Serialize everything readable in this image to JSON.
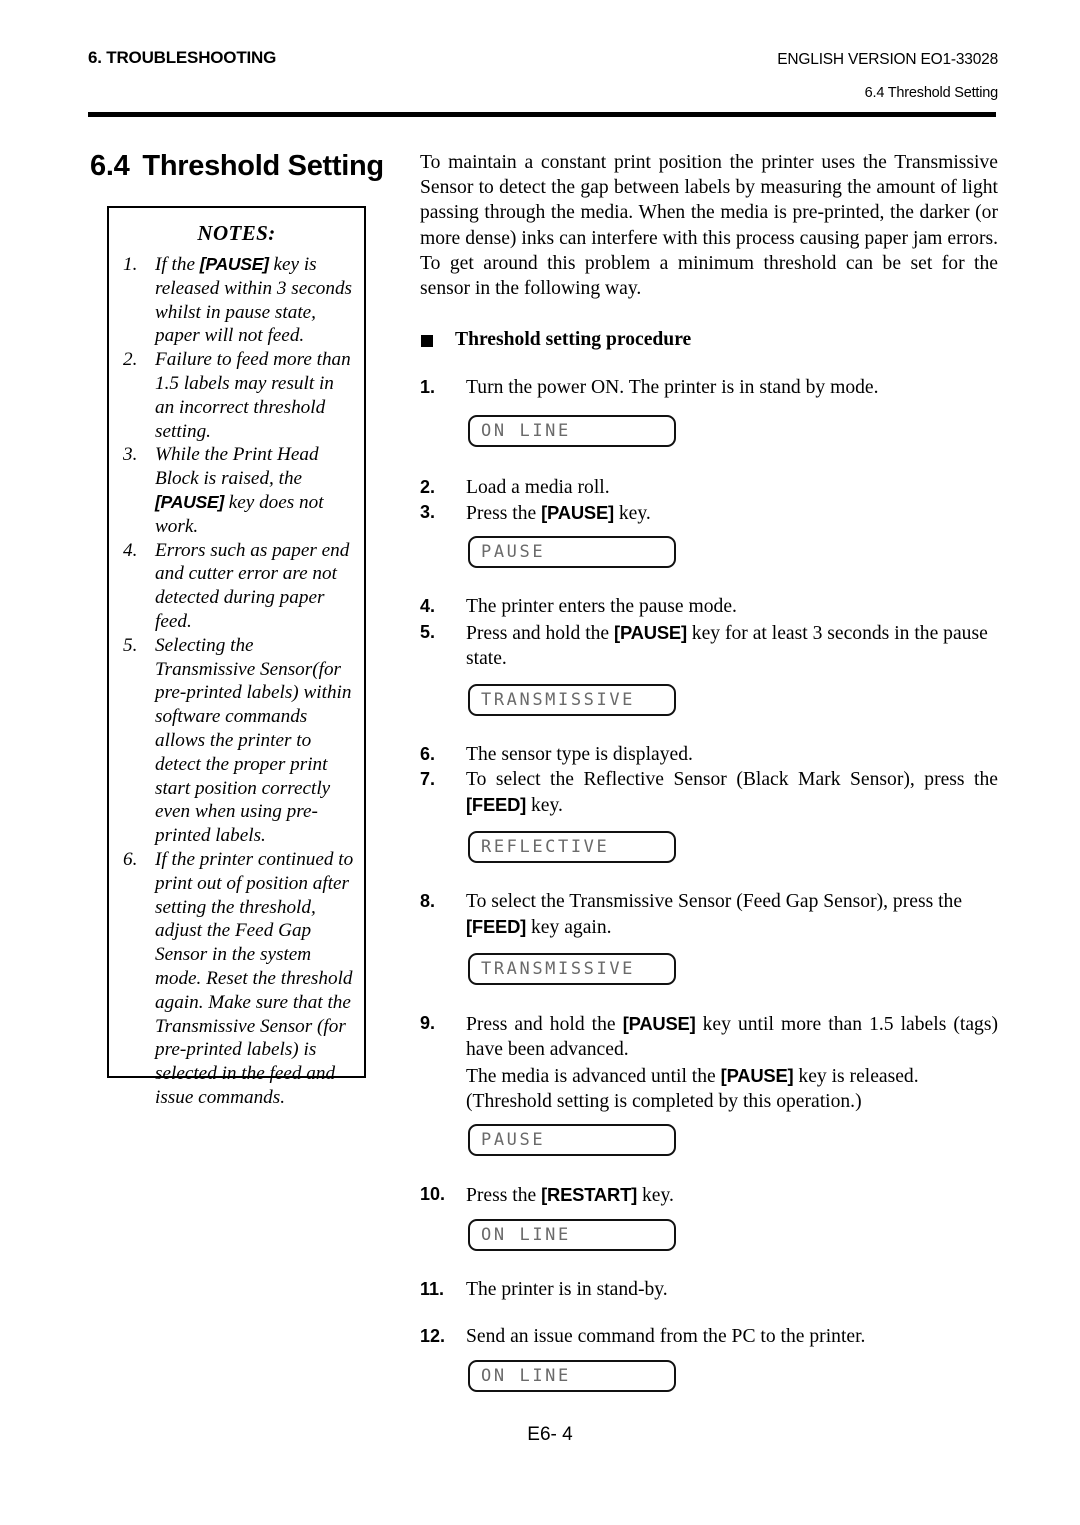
{
  "header": {
    "left": "6. TROUBLESHOOTING",
    "right": "ENGLISH VERSION EO1-33028",
    "sub": "6.4 Threshold Setting"
  },
  "section": {
    "number": "6.4",
    "title": "Threshold Setting"
  },
  "notes": {
    "title": "NOTES:",
    "items": [
      {
        "num": "1.",
        "pre": "If the ",
        "key": "[PAUSE]",
        "post": " key is released within 3 seconds whilst in pause state, paper will not feed."
      },
      {
        "num": "2.",
        "pre": "Failure to feed more than 1.5 labels may result in an incorrect threshold setting.",
        "key": "",
        "post": ""
      },
      {
        "num": "3.",
        "pre": "While the Print Head Block is raised, the ",
        "key": "[PAUSE]",
        "post": " key does not work."
      },
      {
        "num": "4.",
        "pre": "Errors such as paper end and cutter error are not detected during paper feed.",
        "key": "",
        "post": ""
      },
      {
        "num": "5.",
        "pre": "Selecting the Transmissive Sensor(for pre-printed labels) within software commands allows the printer to detect the proper print start position correctly even when using pre-printed labels.",
        "key": "",
        "post": ""
      },
      {
        "num": "6.",
        "pre": "If the printer continued to print out of position after setting the threshold, adjust the Feed Gap Sensor in the system mode.  Reset the threshold again.  Make sure that the Transmissive Sensor (for pre-printed labels) is selected in the feed and issue commands.",
        "key": "",
        "post": ""
      }
    ]
  },
  "main": {
    "intro": "To maintain a constant print position the printer uses the Transmissive Sensor to detect the gap between labels by measuring the amount of light passing through the media.  When the media is pre-printed, the darker (or more dense) inks can interfere with this process causing paper jam errors.  To get around this problem a minimum threshold can be set for the sensor in the following way.",
    "procedure_heading": "Threshold setting procedure",
    "steps": {
      "s1_num": "1.",
      "s1_text": "Turn the power ON.  The printer is in stand by mode.",
      "s2_num": "2.",
      "s2_text": "Load a media roll.",
      "s3_num": "3.",
      "s3_pre": "Press the ",
      "s3_key": "[PAUSE]",
      "s3_post": " key.",
      "s4_num": "4.",
      "s4_text": "The printer enters the pause mode.",
      "s5_num": "5.",
      "s5_pre": "Press and hold the ",
      "s5_key": "[PAUSE]",
      "s5_post": " key for at least 3 seconds in the pause state.",
      "s6_num": "6.",
      "s6_text": "The sensor type is displayed.",
      "s7_num": "7.",
      "s7_pre": "To select the Reflective Sensor (Black Mark Sensor), press the ",
      "s7_key": "[FEED]",
      "s7_post": " key.",
      "s8_num": "8.",
      "s8_pre": "To select the Transmissive Sensor (Feed Gap Sensor), press the ",
      "s8_key": "[FEED]",
      "s8_post": " key again.",
      "s9_num": "9.",
      "s9_pre": "Press and hold the ",
      "s9_key": "[PAUSE]",
      "s9_post": " key until more than 1.5 labels (tags) have been advanced.",
      "s9b_pre": "The media is advanced until the ",
      "s9b_key": "[PAUSE]",
      "s9b_post": " key is released.",
      "s9c_text": "(Threshold setting is completed by this operation.)",
      "s10_num": "10.",
      "s10_pre": "Press the ",
      "s10_key": "[RESTART]",
      "s10_post": " key.",
      "s11_num": "11.",
      "s11_text": "The printer is in stand-by.",
      "s12_num": "12.",
      "s12_text": "Send an issue command from the PC to the printer."
    },
    "displays": {
      "d1": "ON LINE",
      "d2": "PAUSE",
      "d3": "TRANSMISSIVE",
      "d4": "REFLECTIVE",
      "d5": "TRANSMISSIVE",
      "d6": "PAUSE",
      "d7": "ON LINE",
      "d8": "ON LINE"
    }
  },
  "footer": {
    "page": "E6- 4"
  }
}
